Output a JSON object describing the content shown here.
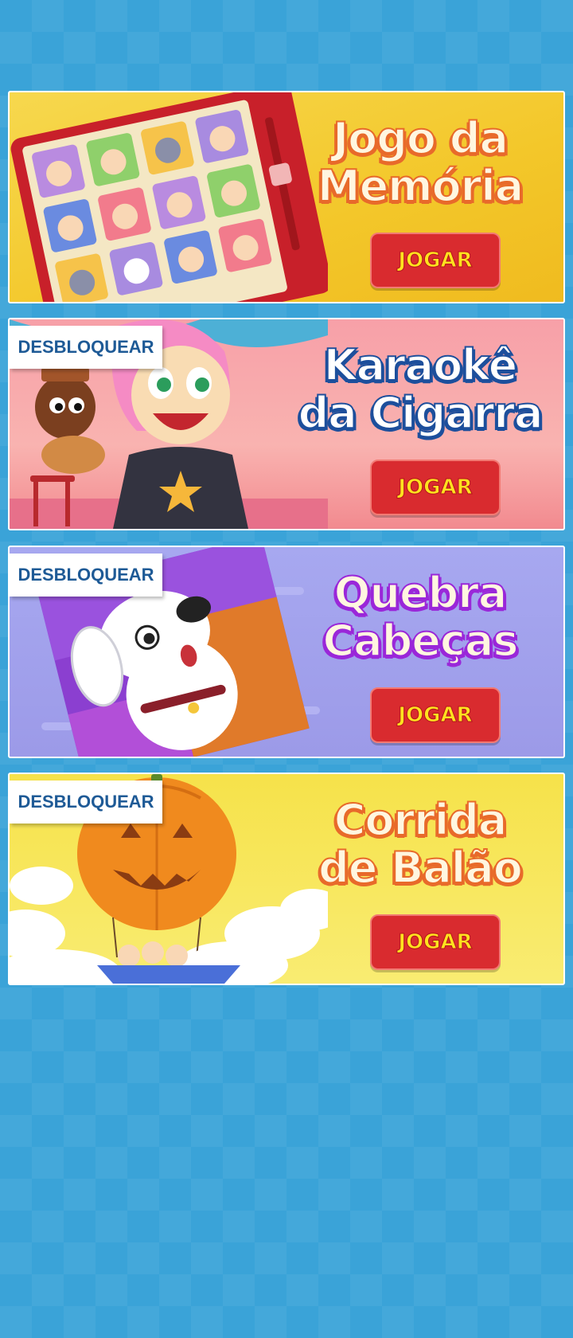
{
  "cards": [
    {
      "title_line1": "Jogo da",
      "title_line2": "Memória",
      "play_label": "JOGAR"
    },
    {
      "unlock_label": "DESBLOQUEAR",
      "title_line1": "Karaokê",
      "title_line2": "da Cigarra",
      "play_label": "JOGAR"
    },
    {
      "unlock_label": "DESBLOQUEAR",
      "title_line1": "Quebra",
      "title_line2": "Cabeças",
      "play_label": "JOGAR"
    },
    {
      "unlock_label": "DESBLOQUEAR",
      "title_line1": "Corrida",
      "title_line2": "de Balão",
      "play_label": "JOGAR"
    }
  ],
  "colors": {
    "background": "#3aa3d8",
    "play_button": "#d92b2f",
    "play_text": "#ffe21f",
    "unlock_text": "#1e5a96"
  }
}
